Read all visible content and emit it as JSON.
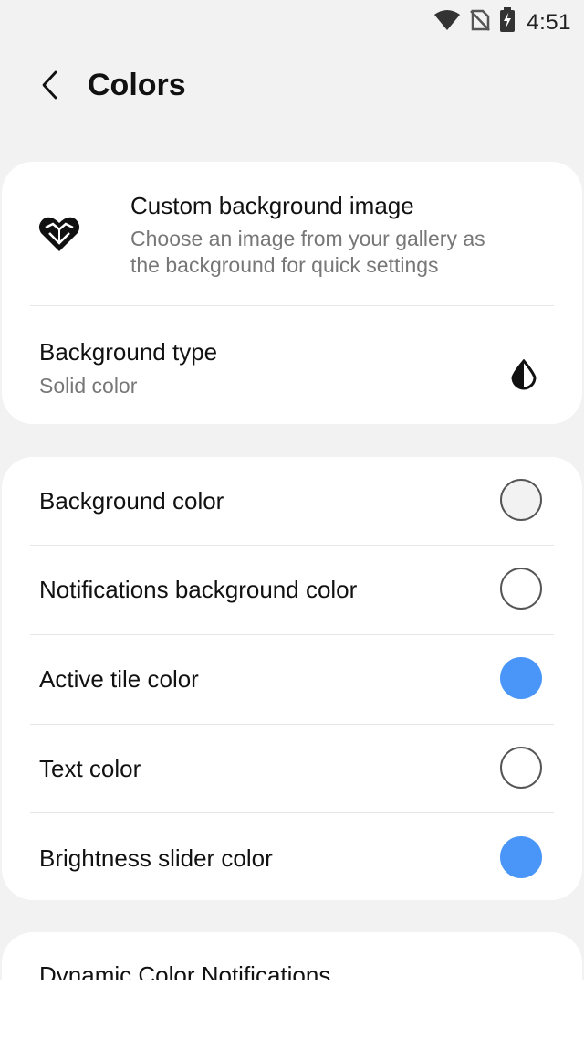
{
  "status_bar": {
    "time": "4:51",
    "icons": [
      "wifi-icon",
      "no-sim-icon",
      "battery-charging-icon"
    ]
  },
  "header": {
    "title": "Colors",
    "back_icon": "chevron-left-icon"
  },
  "card_background": {
    "custom_image": {
      "icon": "heart-image-icon",
      "title": "Custom background image",
      "subtitle_line1": "Choose an image from your gallery as",
      "subtitle_line2": "the background for quick settings"
    },
    "background_type": {
      "title": "Background type",
      "value": "Solid color",
      "icon": "contrast-drop-icon"
    }
  },
  "color_settings": {
    "items": [
      {
        "label": "Background color",
        "swatch_color": "#f2f2f2"
      },
      {
        "label": "Notifications background color",
        "swatch_color": "#ffffff"
      },
      {
        "label": "Active tile color",
        "swatch_color": "#4a96f8"
      },
      {
        "label": "Text color",
        "swatch_color": "#ffffff"
      },
      {
        "label": "Brightness slider color",
        "swatch_color": "#4a96f8"
      }
    ]
  },
  "next_section": {
    "partial_title": "Dynamic Color Notifications"
  },
  "colors": {
    "background": "#f2f2f2",
    "card": "#ffffff",
    "accent": "#4a96f8"
  }
}
